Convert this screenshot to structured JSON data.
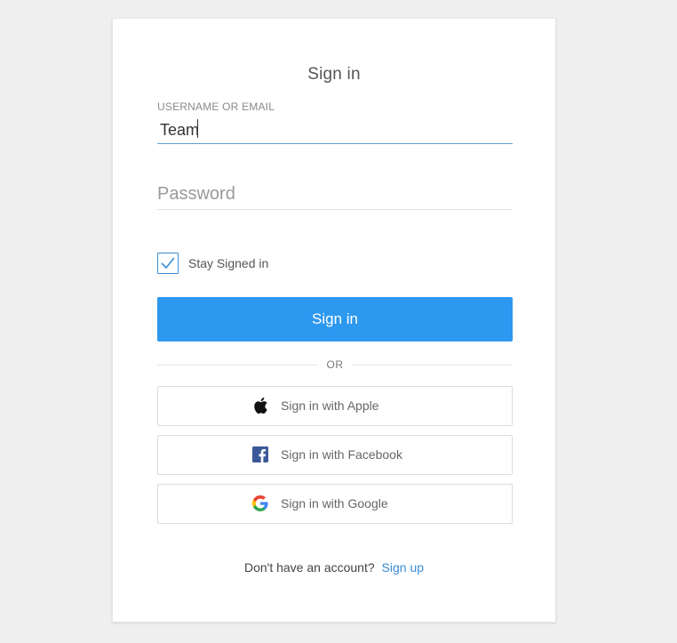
{
  "form": {
    "title": "Sign in",
    "username_label": "USERNAME OR EMAIL",
    "username_value": "Team",
    "password_placeholder": "Password",
    "stay_signed_in_label": "Stay Signed in",
    "stay_signed_in_checked": true,
    "sign_in_button": "Sign in",
    "or_text": "OR"
  },
  "social": {
    "apple": {
      "label": "Sign in with Apple",
      "icon": "apple-icon"
    },
    "facebook": {
      "label": "Sign in with Facebook",
      "icon": "facebook-icon"
    },
    "google": {
      "label": "Sign in with Google",
      "icon": "google-icon"
    }
  },
  "footer": {
    "prompt": "Don't have an account?",
    "link": "Sign up"
  },
  "colors": {
    "accent": "#2d98f0",
    "link": "#3b8ed6",
    "facebook": "#3b5998",
    "page_bg": "#efefef"
  }
}
